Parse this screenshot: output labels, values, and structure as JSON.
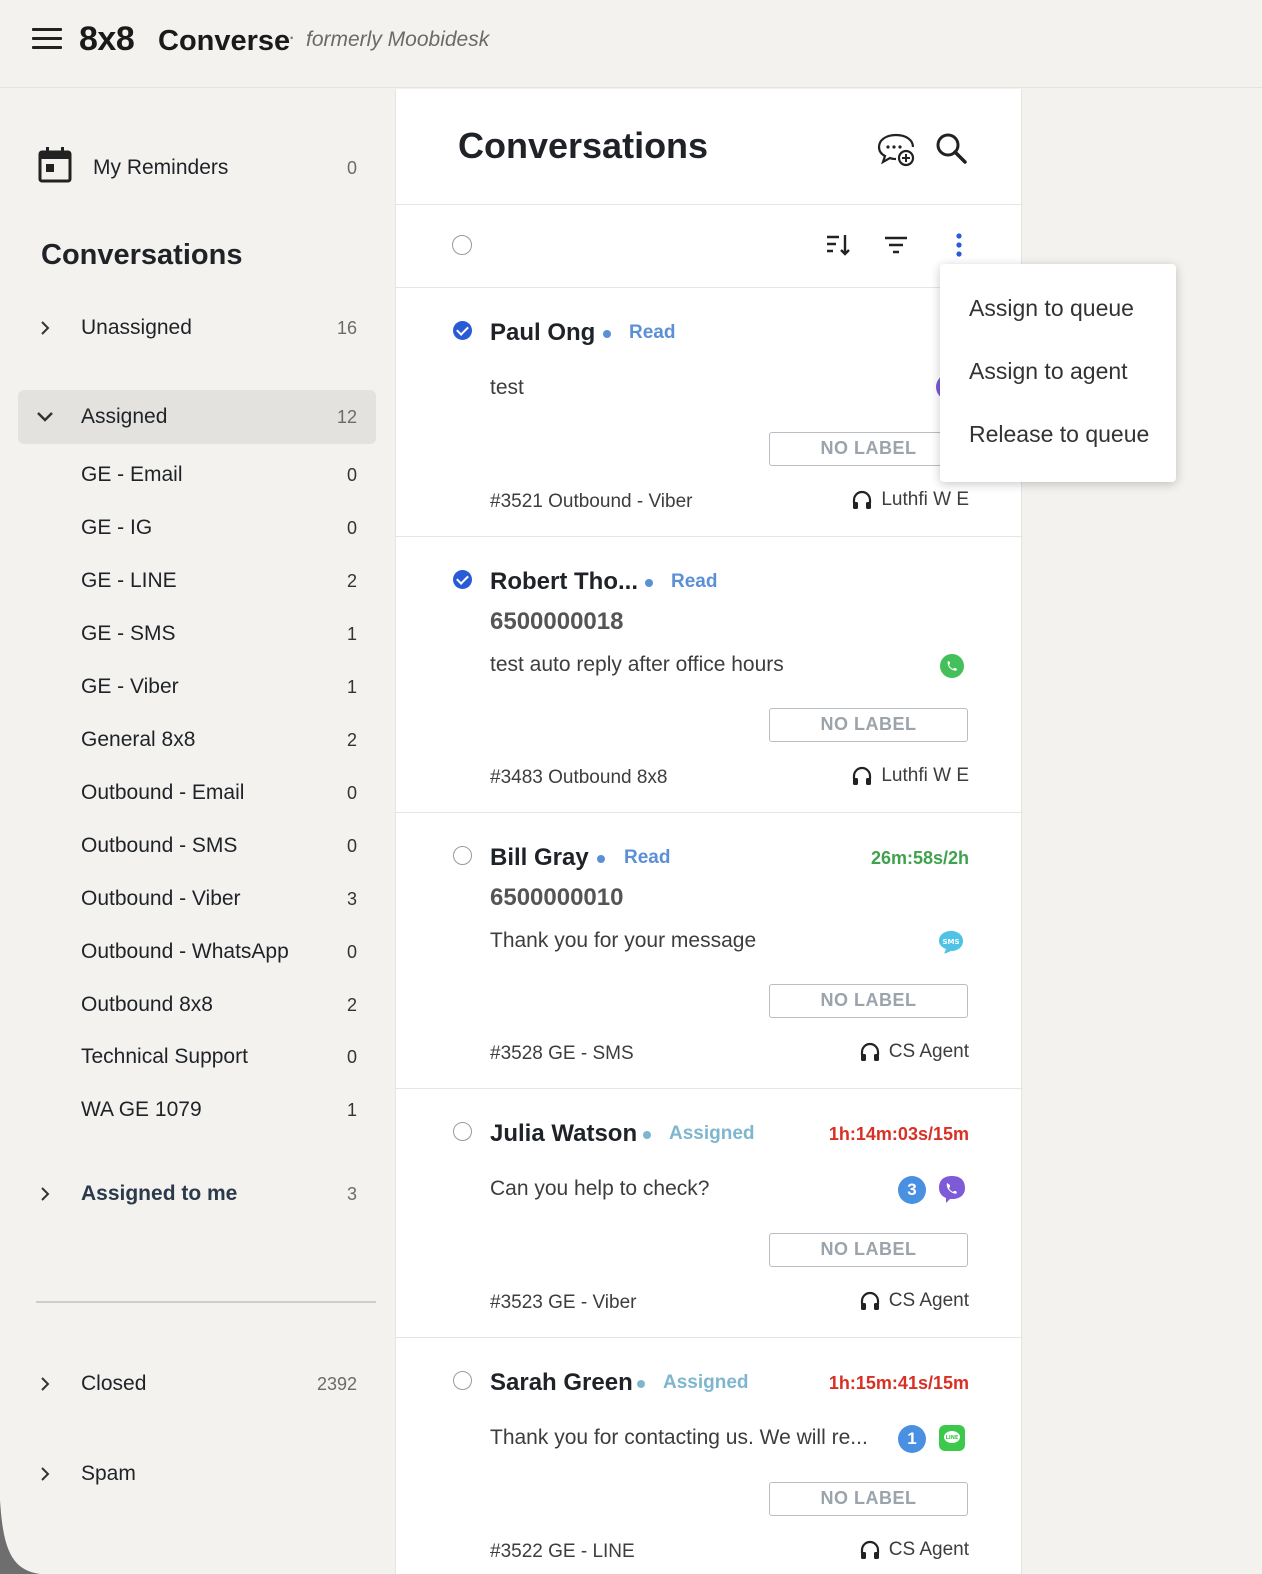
{
  "header": {
    "brand": "8x8",
    "product": "Converse",
    "separator": "·",
    "formerly": "formerly Moobidesk"
  },
  "sidebar": {
    "reminders": {
      "label": "My Reminders",
      "count": "0"
    },
    "heading": "Conversations",
    "unassigned": {
      "label": "Unassigned",
      "count": "16"
    },
    "assigned": {
      "label": "Assigned",
      "count": "12"
    },
    "queues": [
      {
        "label": "GE - Email",
        "count": "0"
      },
      {
        "label": "GE - IG",
        "count": "0"
      },
      {
        "label": "GE - LINE",
        "count": "2"
      },
      {
        "label": "GE - SMS",
        "count": "1"
      },
      {
        "label": "GE - Viber",
        "count": "1"
      },
      {
        "label": "General 8x8",
        "count": "2"
      },
      {
        "label": "Outbound - Email",
        "count": "0"
      },
      {
        "label": "Outbound - SMS",
        "count": "0"
      },
      {
        "label": "Outbound - Viber",
        "count": "3"
      },
      {
        "label": "Outbound - WhatsApp",
        "count": "0"
      },
      {
        "label": "Outbound 8x8",
        "count": "2"
      },
      {
        "label": "Technical Support",
        "count": "0"
      },
      {
        "label": "WA GE 1079",
        "count": "1"
      }
    ],
    "assigned_to_me": {
      "label": "Assigned to me",
      "count": "3"
    },
    "closed": {
      "label": "Closed",
      "count": "2392"
    },
    "spam": {
      "label": "Spam"
    }
  },
  "main": {
    "title": "Conversations",
    "conversations": [
      {
        "name": "Paul Ong",
        "status": "Read",
        "timer": "",
        "phone": "",
        "preview": "test",
        "label": "NO LABEL",
        "ticket": "#3521 Outbound - Viber",
        "agent": "Luthfi W E"
      },
      {
        "name": "Robert Tho...",
        "status": "Read",
        "timer": "",
        "phone": "6500000018",
        "preview": "test auto reply after office hours",
        "label": "NO LABEL",
        "ticket": "#3483 Outbound 8x8",
        "agent": "Luthfi W E"
      },
      {
        "name": "Bill Gray",
        "status": "Read",
        "timer": "26m:58s/2h",
        "phone": "6500000010",
        "preview": "Thank you for your message",
        "label": "NO LABEL",
        "ticket": "#3528 GE - SMS",
        "agent": "CS Agent"
      },
      {
        "name": "Julia Watson",
        "status": "Assigned",
        "timer": "1h:14m:03s/15m",
        "phone": "",
        "preview": "Can you help to check?",
        "badge": "3",
        "label": "NO LABEL",
        "ticket": "#3523 GE - Viber",
        "agent": "CS Agent"
      },
      {
        "name": "Sarah Green",
        "status": "Assigned",
        "timer": "1h:15m:41s/15m",
        "phone": "",
        "preview": "Thank you for contacting us. We will re...",
        "badge": "1",
        "label": "NO LABEL",
        "ticket": "#3522 GE - LINE",
        "agent": "CS Agent"
      }
    ]
  },
  "menu": {
    "items": [
      "Assign to queue",
      "Assign to agent",
      "Release to queue"
    ]
  },
  "colors": {
    "accent_blue": "#2a5bd7",
    "timer_green": "#3fa34d",
    "timer_red": "#d93025",
    "whatsapp": "#43c05a",
    "sms": "#4fc3e6",
    "viber": "#7d5ad8",
    "line": "#3cc84a"
  },
  "icons": {
    "hamburger": "menu-icon",
    "reminders": "calendar-icon",
    "new_chat": "new-chat-icon",
    "search": "search-icon",
    "sort": "sort-icon",
    "filter": "filter-icon",
    "more": "more-vertical-icon",
    "agent": "headset-icon"
  }
}
